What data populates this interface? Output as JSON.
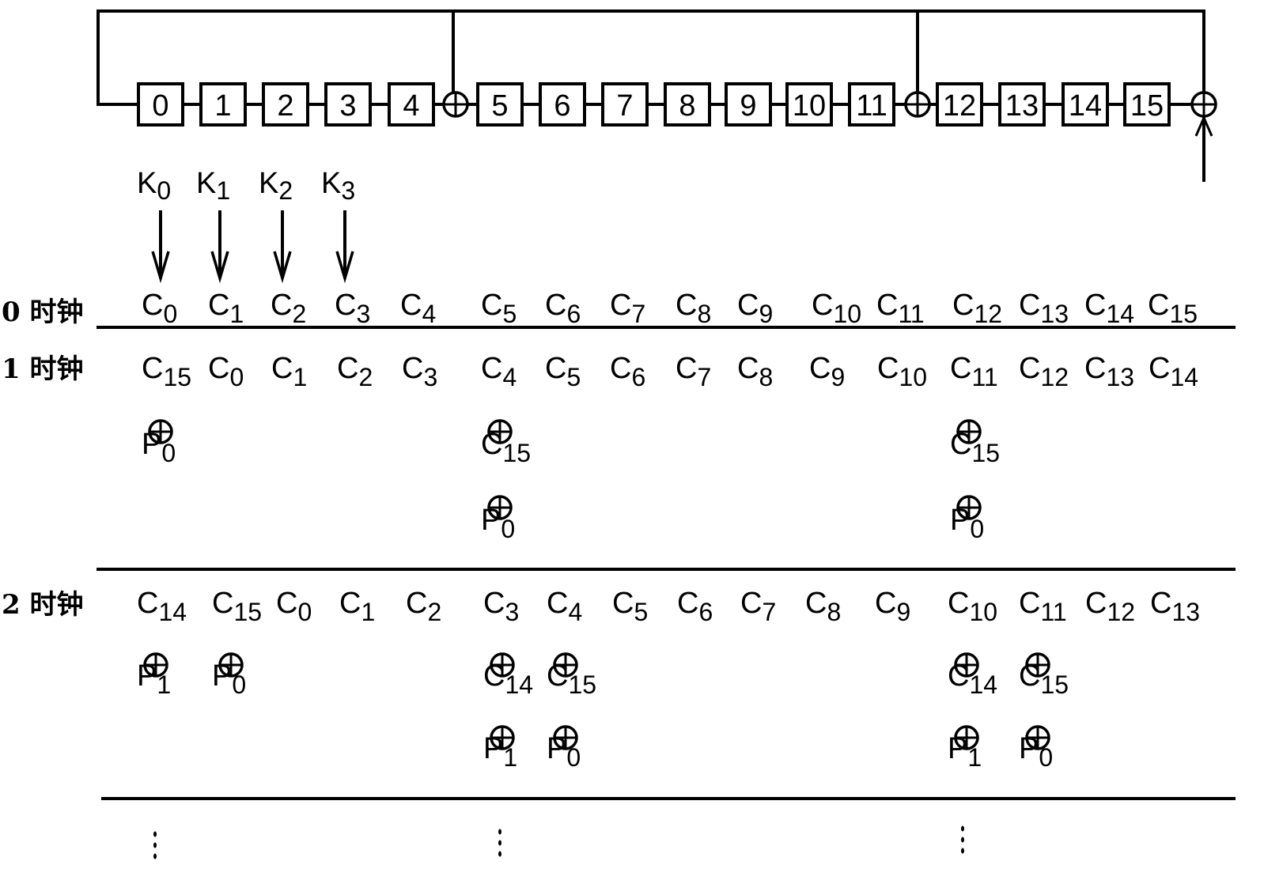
{
  "diagram": {
    "registers": [
      "0",
      "1",
      "2",
      "3",
      "4",
      "5",
      "6",
      "7",
      "8",
      "9",
      "10",
      "11",
      "12",
      "13",
      "14",
      "15"
    ],
    "xor_positions_after_register": [
      4,
      11,
      15
    ],
    "key_inputs": [
      {
        "base": "K",
        "sub": "0",
        "target": 0
      },
      {
        "base": "K",
        "sub": "1",
        "target": 1
      },
      {
        "base": "K",
        "sub": "2",
        "target": 2
      },
      {
        "base": "K",
        "sub": "3",
        "target": 3
      }
    ],
    "xor_symbol": "⊕",
    "ellipsis": "⋮",
    "clocks": [
      {
        "label": "0 时钟",
        "cells": [
          [
            [
              "C",
              "0"
            ]
          ],
          [
            [
              "C",
              "1"
            ]
          ],
          [
            [
              "C",
              "2"
            ]
          ],
          [
            [
              "C",
              "3"
            ]
          ],
          [
            [
              "C",
              "4"
            ]
          ],
          [
            [
              "C",
              "5"
            ]
          ],
          [
            [
              "C",
              "6"
            ]
          ],
          [
            [
              "C",
              "7"
            ]
          ],
          [
            [
              "C",
              "8"
            ]
          ],
          [
            [
              "C",
              "9"
            ]
          ],
          [
            [
              "C",
              "10"
            ]
          ],
          [
            [
              "C",
              "11"
            ]
          ],
          [
            [
              "C",
              "12"
            ]
          ],
          [
            [
              "C",
              "13"
            ]
          ],
          [
            [
              "C",
              "14"
            ]
          ],
          [
            [
              "C",
              "15"
            ]
          ]
        ]
      },
      {
        "label": "1 时钟",
        "cells": [
          [
            [
              "C",
              "15"
            ],
            "xor",
            [
              "P",
              "0"
            ]
          ],
          [
            [
              "C",
              "0"
            ]
          ],
          [
            [
              "C",
              "1"
            ]
          ],
          [
            [
              "C",
              "2"
            ]
          ],
          [
            [
              "C",
              "3"
            ]
          ],
          [
            [
              "C",
              "4"
            ],
            "xor",
            [
              "C",
              "15"
            ],
            "xor",
            [
              "P",
              "0"
            ]
          ],
          [
            [
              "C",
              "5"
            ]
          ],
          [
            [
              "C",
              "6"
            ]
          ],
          [
            [
              "C",
              "7"
            ]
          ],
          [
            [
              "C",
              "8"
            ]
          ],
          [
            [
              "C",
              "9"
            ]
          ],
          [
            [
              "C",
              "10"
            ]
          ],
          [
            [
              "C",
              "11"
            ],
            "xor",
            [
              "C",
              "15"
            ],
            "xor",
            [
              "P",
              "0"
            ]
          ],
          [
            [
              "C",
              "12"
            ]
          ],
          [
            [
              "C",
              "13"
            ]
          ],
          [
            [
              "C",
              "14"
            ]
          ]
        ]
      },
      {
        "label": "2 时钟",
        "cells": [
          [
            [
              "C",
              "14"
            ],
            "xor",
            [
              "P",
              "1"
            ]
          ],
          [
            [
              "C",
              "15"
            ],
            "xor",
            [
              "P",
              "0"
            ]
          ],
          [
            [
              "C",
              "0"
            ]
          ],
          [
            [
              "C",
              "1"
            ]
          ],
          [
            [
              "C",
              "2"
            ]
          ],
          [
            [
              "C",
              "3"
            ],
            "xor",
            [
              "C",
              "14"
            ],
            "xor",
            [
              "P",
              "1"
            ]
          ],
          [
            [
              "C",
              "4"
            ],
            "xor",
            [
              "C",
              "15"
            ],
            "xor",
            [
              "P",
              "0"
            ]
          ],
          [
            [
              "C",
              "5"
            ]
          ],
          [
            [
              "C",
              "6"
            ]
          ],
          [
            [
              "C",
              "7"
            ]
          ],
          [
            [
              "C",
              "8"
            ]
          ],
          [
            [
              "C",
              "9"
            ]
          ],
          [
            [
              "C",
              "10"
            ],
            "xor",
            [
              "C",
              "14"
            ],
            "xor",
            [
              "P",
              "1"
            ]
          ],
          [
            [
              "C",
              "11"
            ],
            "xor",
            [
              "C",
              "15"
            ],
            "xor",
            [
              "P",
              "0"
            ]
          ],
          [
            [
              "C",
              "12"
            ]
          ],
          [
            [
              "C",
              "13"
            ]
          ]
        ]
      }
    ]
  }
}
